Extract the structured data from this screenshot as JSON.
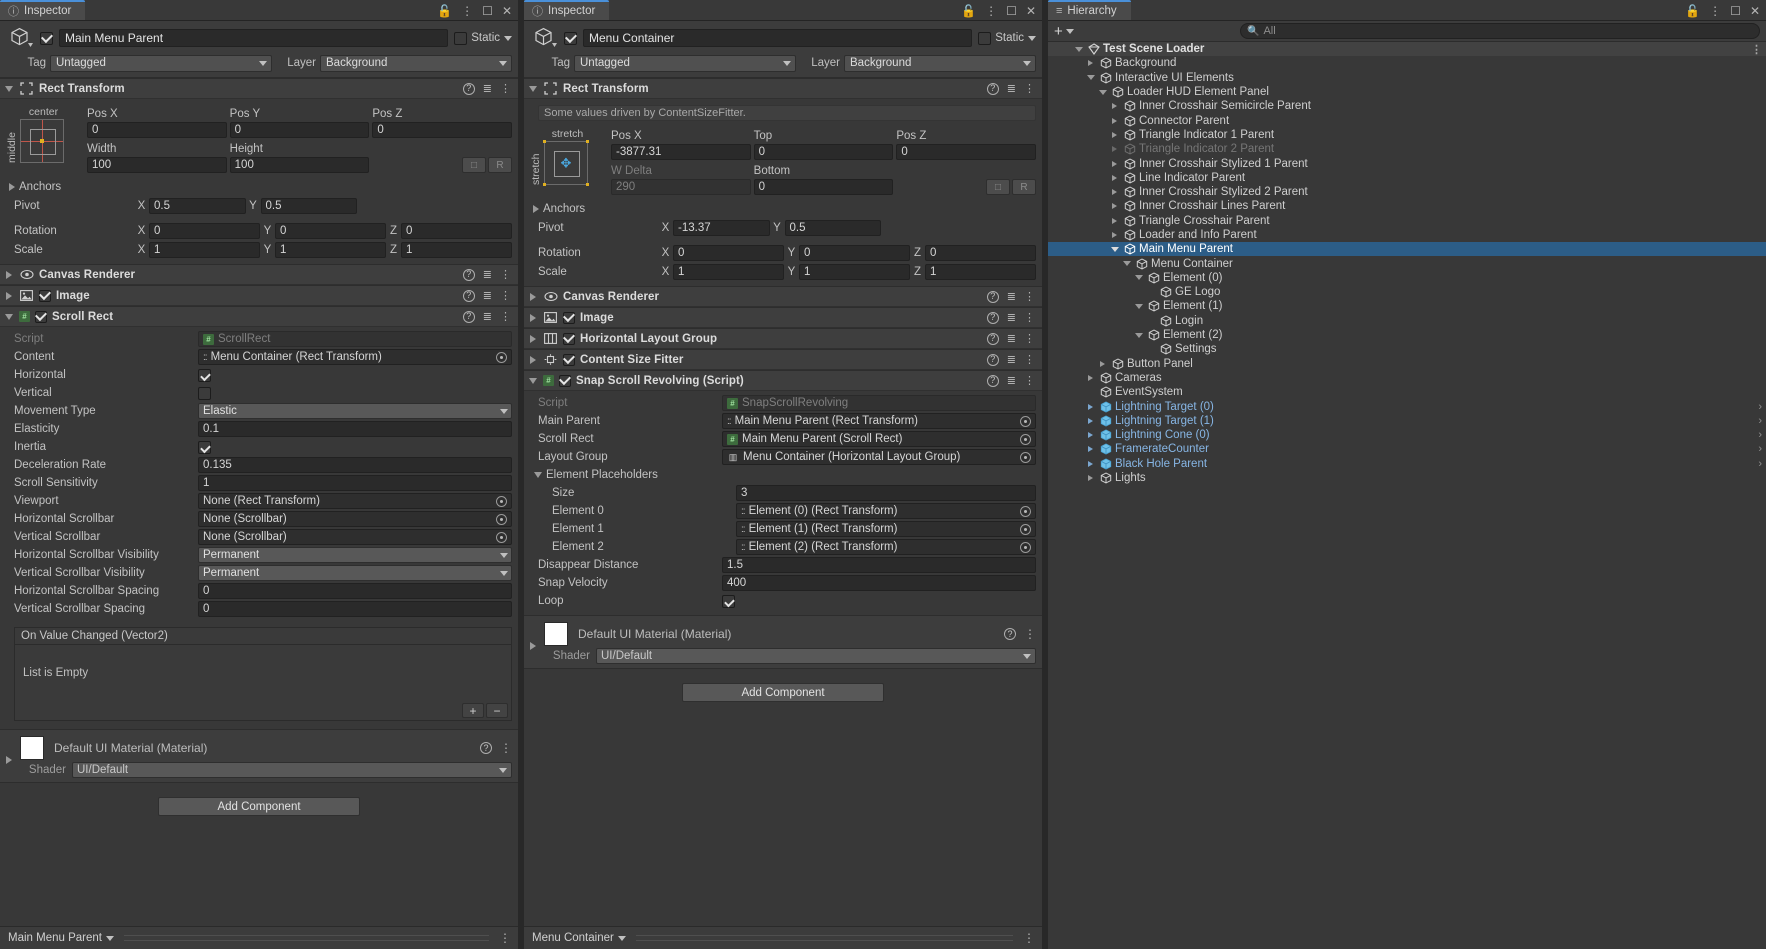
{
  "inspector_a": {
    "tab_label": "Inspector",
    "tab_icon": "info-icon",
    "window_icons": [
      "lock-icon",
      "kebab-icon",
      "maximize-icon",
      "close-icon"
    ],
    "object_name": "Main Menu Parent",
    "enabled": true,
    "static_label": "Static",
    "tag_label": "Tag",
    "tag_value": "Untagged",
    "layer_label": "Layer",
    "layer_value": "Background",
    "rect_transform": {
      "title": "Rect Transform",
      "anchor_preset_top": "center",
      "anchor_preset_left": "middle",
      "headers": [
        "Pos X",
        "Pos Y",
        "Pos Z"
      ],
      "pos": [
        "0",
        "0",
        "0"
      ],
      "size_headers": [
        "Width",
        "Height"
      ],
      "size": [
        "100",
        "100"
      ],
      "anchors_label": "Anchors",
      "pivot_label": "Pivot",
      "pivot": {
        "x": "0.5",
        "y": "0.5"
      },
      "rotation_label": "Rotation",
      "rotation": {
        "x": "0",
        "y": "0",
        "z": "0"
      },
      "scale_label": "Scale",
      "scale": {
        "x": "1",
        "y": "1",
        "z": "1"
      },
      "blueprint_btn": "R"
    },
    "canvas_renderer_title": "Canvas Renderer",
    "image_title": "Image",
    "scroll_rect": {
      "title": "Scroll Rect",
      "enabled": true,
      "rows": [
        {
          "label": "Script",
          "value": "ScrollRect",
          "kind": "script"
        },
        {
          "label": "Content",
          "value": "Menu Container (Rect Transform)",
          "kind": "object"
        },
        {
          "label": "Horizontal",
          "value": "",
          "kind": "check-on"
        },
        {
          "label": "Vertical",
          "value": "",
          "kind": "check-off"
        },
        {
          "label": "Movement Type",
          "value": "Elastic",
          "kind": "enum"
        },
        {
          "label": "Elasticity",
          "value": "0.1",
          "kind": "text"
        },
        {
          "label": "Inertia",
          "value": "",
          "kind": "check-on"
        },
        {
          "label": "Deceleration Rate",
          "value": "0.135",
          "kind": "text"
        },
        {
          "label": "Scroll Sensitivity",
          "value": "1",
          "kind": "text"
        },
        {
          "label": "Viewport",
          "value": "None (Rect Transform)",
          "kind": "objref"
        },
        {
          "label": "Horizontal Scrollbar",
          "value": "None (Scrollbar)",
          "kind": "objref"
        },
        {
          "label": "Vertical Scrollbar",
          "value": "None (Scrollbar)",
          "kind": "objref"
        },
        {
          "label": "Horizontal Scrollbar Visibility",
          "value": "Permanent",
          "kind": "enum"
        },
        {
          "label": "Vertical Scrollbar Visibility",
          "value": "Permanent",
          "kind": "enum"
        },
        {
          "label": "Horizontal Scrollbar Spacing",
          "value": "0",
          "kind": "text"
        },
        {
          "label": "Vertical Scrollbar Spacing",
          "value": "0",
          "kind": "text"
        }
      ],
      "event_header": "On Value Changed (Vector2)",
      "event_empty": "List is Empty",
      "event_add": "+",
      "event_remove": "−"
    },
    "material": {
      "title": "Default UI Material (Material)",
      "shader_label": "Shader",
      "shader_value": "UI/Default"
    },
    "add_component": "Add Component",
    "breadcrumb": "Main Menu Parent"
  },
  "inspector_b": {
    "tab_label": "Inspector",
    "tab_icon": "info-icon",
    "object_name": "Menu Container",
    "enabled": true,
    "static_label": "Static",
    "tag_label": "Tag",
    "tag_value": "Untagged",
    "layer_label": "Layer",
    "layer_value": "Background",
    "rect_transform": {
      "title": "Rect Transform",
      "driven_notice": "Some values driven by ContentSizeFitter.",
      "anchor_preset_top": "stretch",
      "anchor_preset_left": "stretch",
      "headers": [
        "Pos X",
        "Top",
        "Pos Z"
      ],
      "pos": [
        "-3877.31",
        "0",
        "0"
      ],
      "size_headers": [
        "W Delta",
        "Bottom"
      ],
      "size": [
        "290",
        "0"
      ],
      "anchors_label": "Anchors",
      "pivot_label": "Pivot",
      "pivot": {
        "x": "-13.37",
        "y": "0.5"
      },
      "rotation_label": "Rotation",
      "rotation": {
        "x": "0",
        "y": "0",
        "z": "0"
      },
      "scale_label": "Scale",
      "scale": {
        "x": "1",
        "y": "1",
        "z": "1"
      },
      "blueprint_btn": "R"
    },
    "canvas_renderer_title": "Canvas Renderer",
    "image_title": "Image",
    "horizontal_layout_group_title": "Horizontal Layout Group",
    "content_size_fitter_title": "Content Size Fitter",
    "snap_scroll": {
      "title": "Snap Scroll Revolving (Script)",
      "enabled": true,
      "rows": [
        {
          "label": "Script",
          "value": "SnapScrollRevolving",
          "kind": "script"
        },
        {
          "label": "Main Parent",
          "value": "Main Menu Parent (Rect Transform)",
          "kind": "object"
        },
        {
          "label": "Scroll Rect",
          "value": "Main Menu Parent (Scroll Rect)",
          "kind": "scriptref"
        },
        {
          "label": "Layout Group",
          "value": "Menu Container (Horizontal Layout Group)",
          "kind": "layoutref"
        }
      ],
      "placeholders_label": "Element Placeholders",
      "size_label": "Size",
      "size_value": "3",
      "elements": [
        {
          "label": "Element 0",
          "value": "Element (0) (Rect Transform)"
        },
        {
          "label": "Element 1",
          "value": "Element (1) (Rect Transform)"
        },
        {
          "label": "Element 2",
          "value": "Element (2) (Rect Transform)"
        }
      ],
      "tail_rows": [
        {
          "label": "Disappear Distance",
          "value": "1.5",
          "kind": "text"
        },
        {
          "label": "Snap Velocity",
          "value": "400",
          "kind": "text"
        },
        {
          "label": "Loop",
          "value": "",
          "kind": "check-on"
        }
      ]
    },
    "material": {
      "title": "Default UI Material (Material)",
      "shader_label": "Shader",
      "shader_value": "UI/Default"
    },
    "add_component": "Add Component",
    "breadcrumb": "Menu Container"
  },
  "hierarchy": {
    "tab_label": "Hierarchy",
    "tab_icon": "hierarchy-icon",
    "add_button": "+",
    "search_placeholder": "All",
    "search_value": "",
    "items": [
      {
        "label": "Test Scene Loader",
        "depth": 0,
        "arrow": "down",
        "icon": "scene-icon",
        "style": "scene",
        "right": "kebab"
      },
      {
        "label": "Background",
        "depth": 1,
        "arrow": "right",
        "icon": "gameobject-icon",
        "style": "normal"
      },
      {
        "label": "Interactive UI Elements",
        "depth": 1,
        "arrow": "down",
        "icon": "gameobject-icon",
        "style": "normal"
      },
      {
        "label": "Loader HUD Element Panel",
        "depth": 2,
        "arrow": "down",
        "icon": "gameobject-icon",
        "style": "normal"
      },
      {
        "label": "Inner Crosshair Semicircle Parent",
        "depth": 3,
        "arrow": "right",
        "icon": "gameobject-icon",
        "style": "normal"
      },
      {
        "label": "Connector Parent",
        "depth": 3,
        "arrow": "right",
        "icon": "gameobject-icon",
        "style": "normal"
      },
      {
        "label": "Triangle Indicator 1 Parent",
        "depth": 3,
        "arrow": "right",
        "icon": "gameobject-icon",
        "style": "normal"
      },
      {
        "label": "Triangle Indicator 2 Parent",
        "depth": 3,
        "arrow": "right",
        "icon": "gameobject-icon",
        "style": "dim"
      },
      {
        "label": "Inner Crosshair Stylized 1 Parent",
        "depth": 3,
        "arrow": "right",
        "icon": "gameobject-icon",
        "style": "normal"
      },
      {
        "label": "Line Indicator Parent",
        "depth": 3,
        "arrow": "right",
        "icon": "gameobject-icon",
        "style": "normal"
      },
      {
        "label": "Inner Crosshair Stylized 2 Parent",
        "depth": 3,
        "arrow": "right",
        "icon": "gameobject-icon",
        "style": "normal"
      },
      {
        "label": "Inner Crosshair Lines Parent",
        "depth": 3,
        "arrow": "right",
        "icon": "gameobject-icon",
        "style": "normal"
      },
      {
        "label": "Triangle Crosshair Parent",
        "depth": 3,
        "arrow": "right",
        "icon": "gameobject-icon",
        "style": "normal"
      },
      {
        "label": "Loader and Info Parent",
        "depth": 3,
        "arrow": "right",
        "icon": "gameobject-icon",
        "style": "normal"
      },
      {
        "label": "Main Menu Parent",
        "depth": 3,
        "arrow": "down",
        "icon": "gameobject-icon",
        "style": "selected"
      },
      {
        "label": "Menu Container",
        "depth": 4,
        "arrow": "down",
        "icon": "gameobject-icon",
        "style": "normal"
      },
      {
        "label": "Element (0)",
        "depth": 5,
        "arrow": "down",
        "icon": "gameobject-icon",
        "style": "normal"
      },
      {
        "label": "GE Logo",
        "depth": 6,
        "arrow": "none",
        "icon": "gameobject-icon",
        "style": "normal"
      },
      {
        "label": "Element (1)",
        "depth": 5,
        "arrow": "down",
        "icon": "gameobject-icon",
        "style": "normal"
      },
      {
        "label": "Login",
        "depth": 6,
        "arrow": "none",
        "icon": "gameobject-icon",
        "style": "normal"
      },
      {
        "label": "Element (2)",
        "depth": 5,
        "arrow": "down",
        "icon": "gameobject-icon",
        "style": "normal"
      },
      {
        "label": "Settings",
        "depth": 6,
        "arrow": "none",
        "icon": "gameobject-icon",
        "style": "normal"
      },
      {
        "label": "Button Panel",
        "depth": 2,
        "arrow": "right",
        "icon": "gameobject-icon",
        "style": "normal"
      },
      {
        "label": "Cameras",
        "depth": 1,
        "arrow": "right",
        "icon": "gameobject-icon",
        "style": "normal"
      },
      {
        "label": "EventSystem",
        "depth": 1,
        "arrow": "none",
        "icon": "gameobject-icon",
        "style": "normal"
      },
      {
        "label": "Lightning Target (0)",
        "depth": 1,
        "arrow": "right",
        "icon": "prefab-icon",
        "style": "prefab",
        "right": "chevron"
      },
      {
        "label": "Lightning Target (1)",
        "depth": 1,
        "arrow": "right",
        "icon": "prefab-icon",
        "style": "prefab",
        "right": "chevron"
      },
      {
        "label": "Lightning Cone (0)",
        "depth": 1,
        "arrow": "right",
        "icon": "prefab-icon",
        "style": "prefab",
        "right": "chevron"
      },
      {
        "label": "FramerateCounter",
        "depth": 1,
        "arrow": "right",
        "icon": "prefab-icon",
        "style": "prefab",
        "right": "chevron"
      },
      {
        "label": "Black Hole Parent",
        "depth": 1,
        "arrow": "right",
        "icon": "prefab-icon",
        "style": "prefab",
        "right": "chevron"
      },
      {
        "label": "Lights",
        "depth": 1,
        "arrow": "right",
        "icon": "gameobject-icon",
        "style": "normal"
      }
    ]
  },
  "colors": {
    "panel_bg": "#383838",
    "header_bg": "#3c3c3c",
    "selection_blue": "#2c5d87",
    "tab_accent": "#4a90d9",
    "prefab_blue": "#87b6e5",
    "pivot_yellow": "#e0b020",
    "anchor_red": "#c0564a"
  }
}
